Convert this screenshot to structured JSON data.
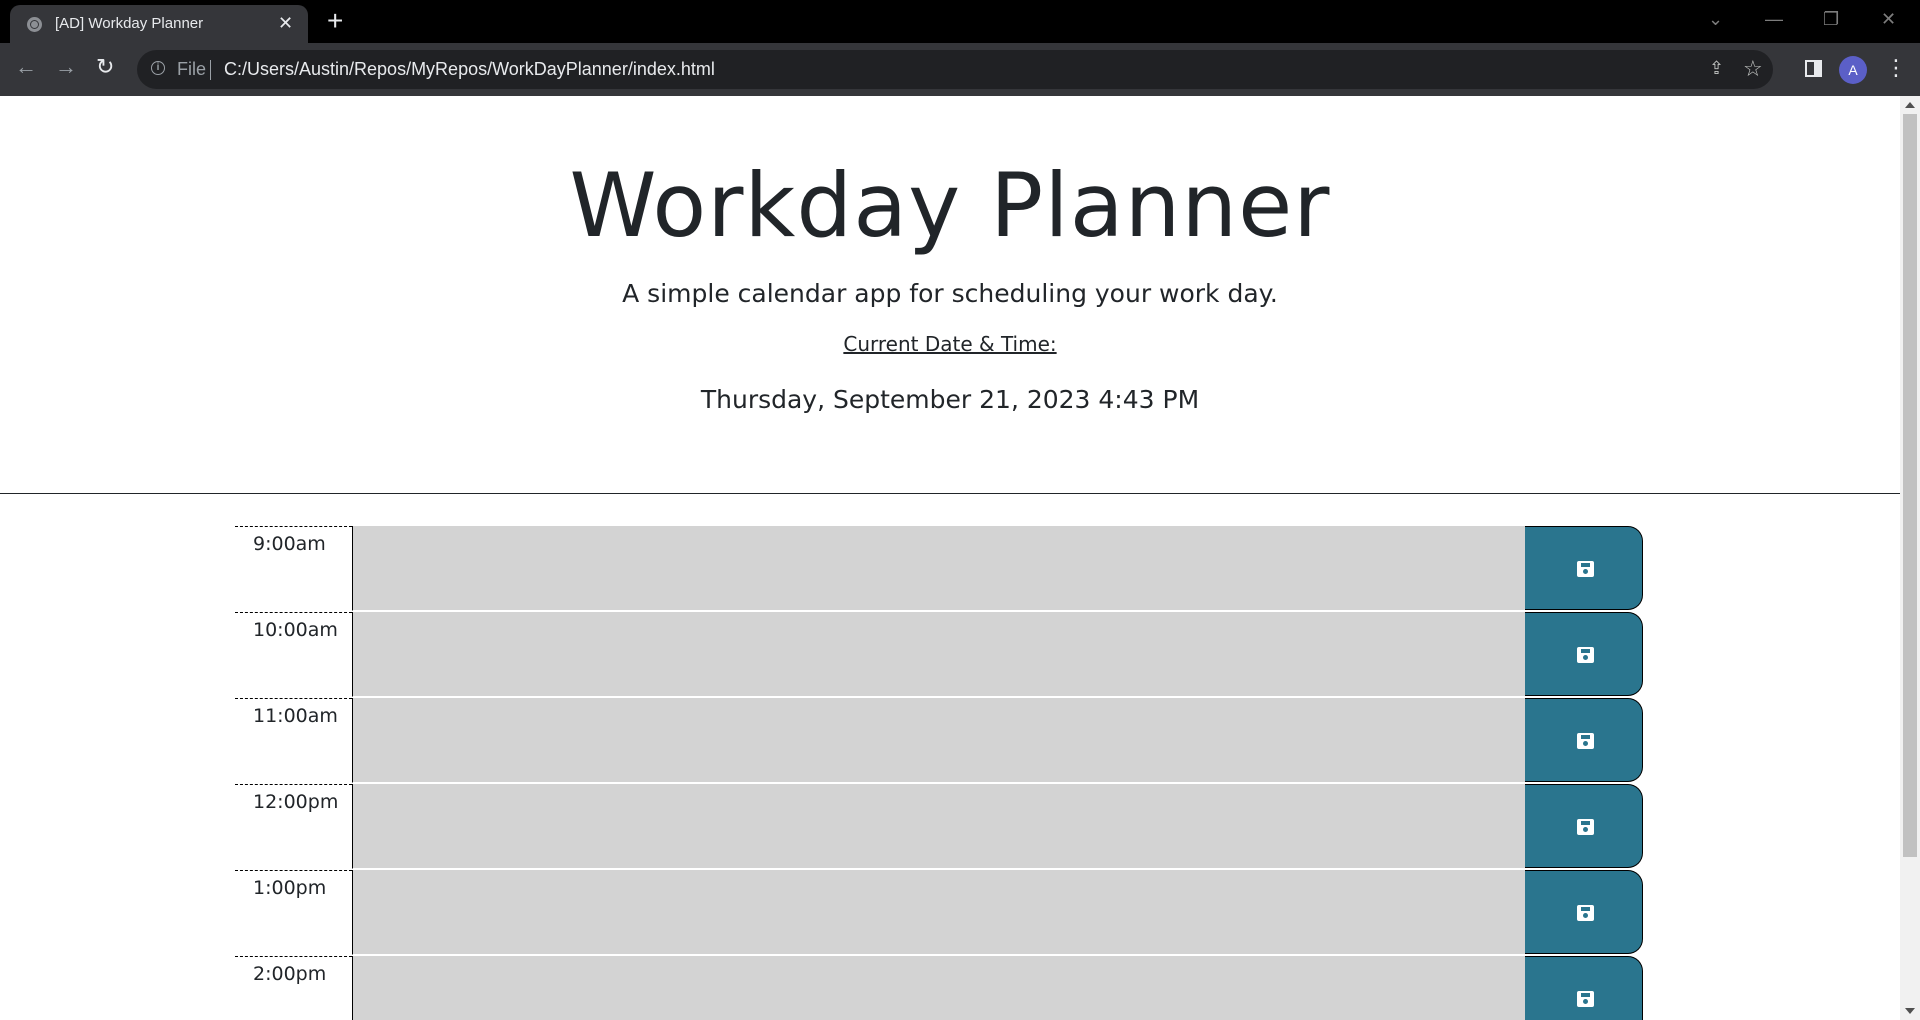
{
  "browser": {
    "tab_title": "[AD] Workday Planner",
    "tab_close": "✕",
    "new_tab": "+",
    "window_controls": {
      "dropdown": "⌄",
      "minimize": "—",
      "restore": "❐",
      "close": "✕"
    },
    "nav": {
      "back": "←",
      "forward": "→",
      "reload": "↻"
    },
    "address": {
      "scheme_label": "File",
      "url": "C:/Users/Austin/Repos/MyRepos/WorkDayPlanner/index.html"
    },
    "profile_initial": "A",
    "menu": "⋮",
    "icons": {
      "share": "share-icon",
      "bookmark": "star-icon",
      "side_panel": "side-panel-icon"
    }
  },
  "header": {
    "title": "Workday Planner",
    "subtitle": "A simple calendar app for scheduling your work day.",
    "date_label": "Current Date & Time:",
    "current_day": "Thursday, September 21, 2023 4:43 PM"
  },
  "time_blocks": [
    {
      "hour": "9:00am",
      "text": "",
      "state": "past"
    },
    {
      "hour": "10:00am",
      "text": "",
      "state": "past"
    },
    {
      "hour": "11:00am",
      "text": "",
      "state": "past"
    },
    {
      "hour": "12:00pm",
      "text": "",
      "state": "past"
    },
    {
      "hour": "1:00pm",
      "text": "",
      "state": "past"
    },
    {
      "hour": "2:00pm",
      "text": "",
      "state": "past"
    }
  ],
  "colors": {
    "past_block": "#d3d3d3",
    "save_button": "#2a758e",
    "text": "#212529"
  },
  "save_icon": "floppy-disk-icon"
}
